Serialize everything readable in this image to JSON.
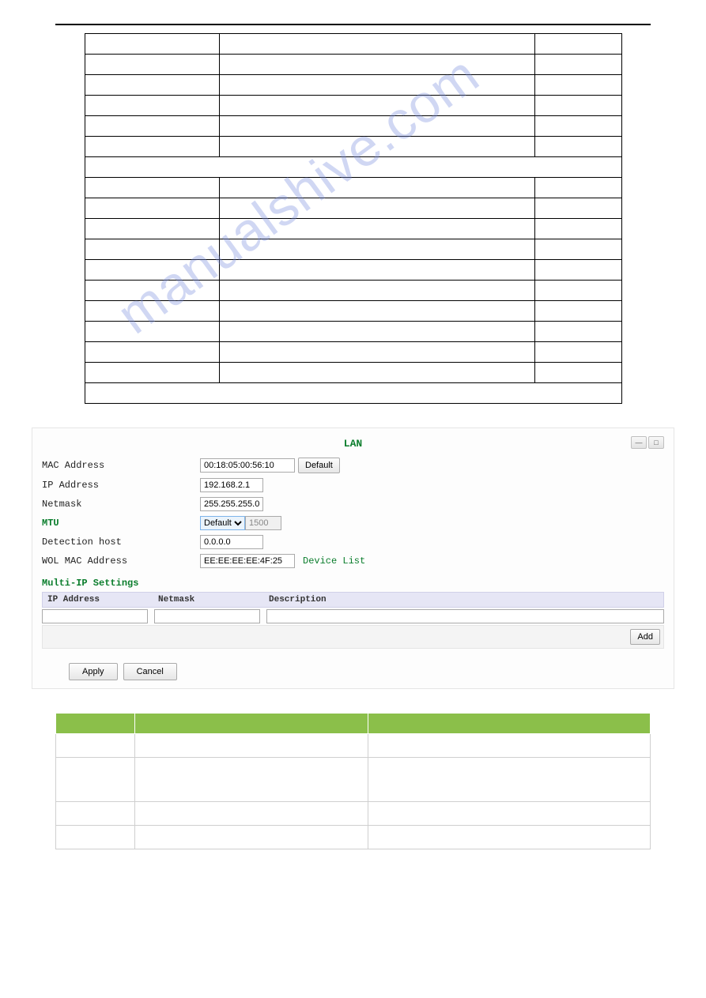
{
  "watermark": "manualshive.com",
  "lan": {
    "title": "LAN",
    "mac_label": "MAC Address",
    "mac_value": "00:18:05:00:56:10",
    "default_btn": "Default",
    "ip_label": "IP Address",
    "ip_value": "192.168.2.1",
    "netmask_label": "Netmask",
    "netmask_value": "255.255.255.0",
    "mtu_label": "MTU",
    "mtu_select": "Default",
    "mtu_num": "1500",
    "detect_label": "Detection host",
    "detect_value": "0.0.0.0",
    "wol_label": "WOL MAC Address",
    "wol_value": "EE:EE:EE:EE:4F:25",
    "device_list": "Device List"
  },
  "multi_ip": {
    "heading": "Multi-IP Settings",
    "col_ip": "IP Address",
    "col_netmask": "Netmask",
    "col_desc": "Description",
    "add_btn": "Add"
  },
  "actions": {
    "apply": "Apply",
    "cancel": "Cancel"
  }
}
